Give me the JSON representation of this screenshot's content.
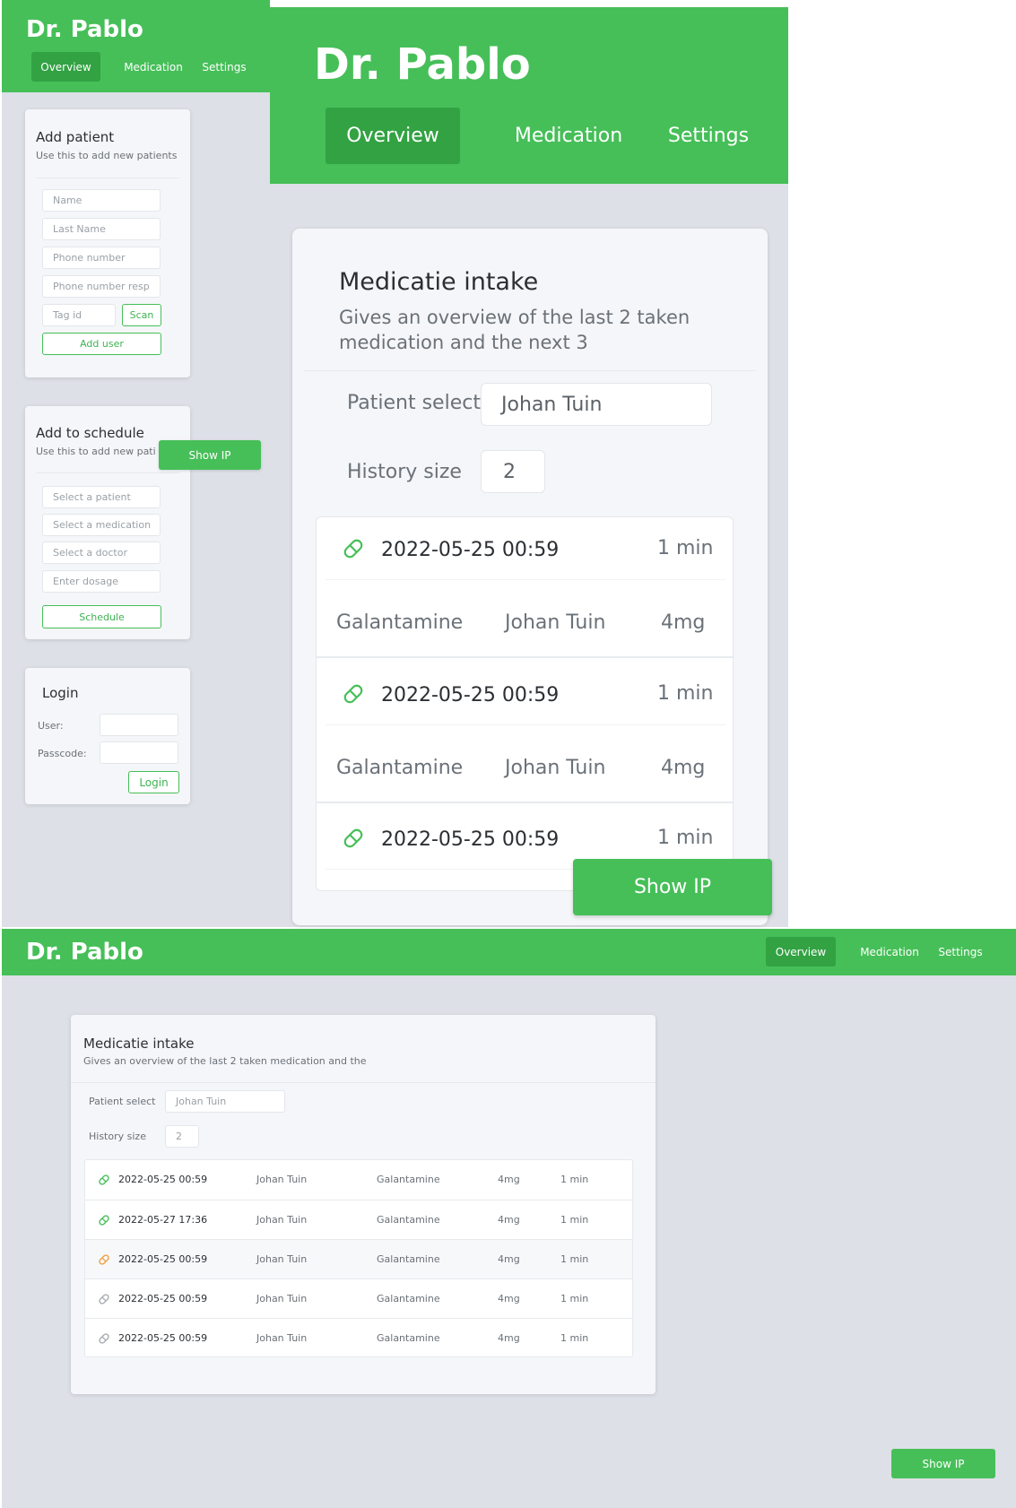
{
  "app_title": "Dr. Pablo",
  "nav": [
    "Overview",
    "Medication",
    "Settings"
  ],
  "show_ip": "Show IP",
  "add_patient": {
    "title": "Add patient",
    "subtitle": "Use this to add new patients",
    "placeholders": [
      "Name",
      "Last Name",
      "Phone number",
      "Phone number resp"
    ],
    "tag_placeholder": "Tag id",
    "scan": "Scan",
    "add_user": "Add user"
  },
  "schedule": {
    "title": "Add to schedule",
    "subtitle": "Use this to add new pati",
    "placeholders": [
      "Select  a patient",
      "Select a medication",
      "Select a doctor",
      "Enter dosage"
    ],
    "button": "Schedule"
  },
  "login": {
    "title": "Login",
    "user_label": "User:",
    "pass_label": "Passcode:",
    "button": "Login"
  },
  "intake_mobile": {
    "title": "Medicatie intake",
    "subtitle_1": "Gives an overview of the last 2 taken",
    "subtitle_2": "medication and the next 3",
    "patient_label": "Patient select",
    "patient_value": "Johan Tuin",
    "history_label": "History size",
    "history_value": "2",
    "entries": [
      {
        "date": "2022-05-25 00:59",
        "time": "1 min",
        "med": "Galantamine",
        "patient": "Johan Tuin",
        "dose": "4mg"
      },
      {
        "date": "2022-05-25 00:59",
        "time": "1 min",
        "med": "Galantamine",
        "patient": "Johan Tuin",
        "dose": "4mg"
      },
      {
        "date": "2022-05-25 00:59",
        "time": "1 min"
      }
    ]
  },
  "intake_desktop": {
    "title": "Medicatie intake",
    "subtitle": "Gives an overview of the last 2 taken medication and the",
    "patient_label": "Patient select",
    "patient_value": "Johan Tuin",
    "history_label": "History size",
    "history_value": "2",
    "rows": [
      {
        "date": "2022-05-25 00:59",
        "patient": "Johan Tuin",
        "med": "Galantamine",
        "dose": "4mg",
        "time": "1 min",
        "icon_color": "#46bf58"
      },
      {
        "date": "2022-05-27 17:36",
        "patient": "Johan Tuin",
        "med": "Galantamine",
        "dose": "4mg",
        "time": "1 min",
        "icon_color": "#46bf58"
      },
      {
        "date": "2022-05-25 00:59",
        "patient": "Johan Tuin",
        "med": "Galantamine",
        "dose": "4mg",
        "time": "1 min",
        "icon_color": "#f0a040"
      },
      {
        "date": "2022-05-25 00:59",
        "patient": "Johan Tuin",
        "med": "Galantamine",
        "dose": "4mg",
        "time": "1 min",
        "icon_color": "#a8acb2"
      },
      {
        "date": "2022-05-25 00:59",
        "patient": "Johan Tuin",
        "med": "Galantamine",
        "dose": "4mg",
        "time": "1 min",
        "icon_color": "#a8acb2"
      }
    ]
  },
  "colors": {
    "accent": "#46bf58",
    "accent_dark": "#32a243",
    "background": "#dde0e7"
  }
}
